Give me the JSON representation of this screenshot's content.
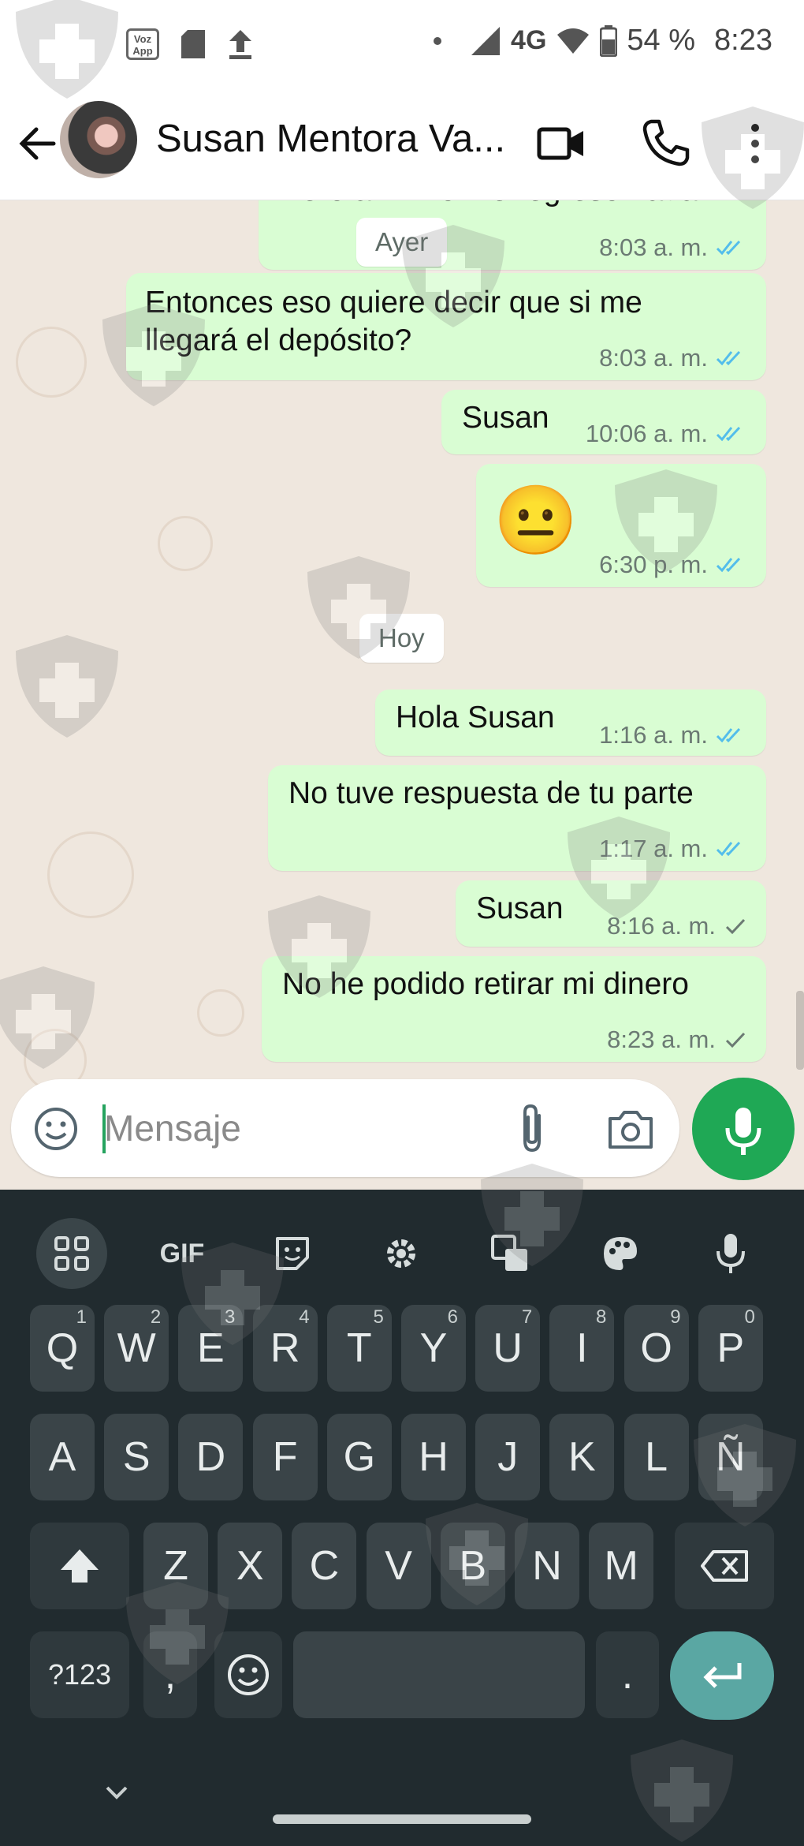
{
  "status_bar": {
    "vozapp_label": "Voz App",
    "network": "4G",
    "battery": "54 %",
    "time": "8:23"
  },
  "header": {
    "contact_name": "Susan Mentora Va..."
  },
  "chat": {
    "partial_message": {
      "text": "Pero a mí no me regresó nada",
      "time": "8:03 a. m."
    },
    "day_labels": {
      "yesterday": "Ayer",
      "today": "Hoy"
    },
    "messages": [
      {
        "text_line1": "Entonces eso quiere decir que si me",
        "text_line2": "llegará el depósito?",
        "time": "8:03 a. m.",
        "status": "read"
      },
      {
        "text": "Susan",
        "time": "10:06 a. m.",
        "status": "read"
      },
      {
        "emoji": "😐",
        "time": "6:30 p. m.",
        "status": "read"
      },
      {
        "text": "Hola Susan",
        "time": "1:16 a. m.",
        "status": "read"
      },
      {
        "text": "No tuve respuesta de tu parte",
        "time": "1:17 a. m.",
        "status": "read"
      },
      {
        "text": "Susan",
        "time": "8:16 a. m.",
        "status": "sent"
      },
      {
        "text": "No he podido retirar mi dinero",
        "time": "8:23 a. m.",
        "status": "sent"
      }
    ]
  },
  "input": {
    "placeholder": "Mensaje"
  },
  "keyboard": {
    "toolbar": [
      "apps-grid",
      "GIF",
      "sticker",
      "settings",
      "translate",
      "theme",
      "voice"
    ],
    "gif_label": "GIF",
    "row1": [
      {
        "k": "Q",
        "n": "1"
      },
      {
        "k": "W",
        "n": "2"
      },
      {
        "k": "E",
        "n": "3"
      },
      {
        "k": "R",
        "n": "4"
      },
      {
        "k": "T",
        "n": "5"
      },
      {
        "k": "Y",
        "n": "6"
      },
      {
        "k": "U",
        "n": "7"
      },
      {
        "k": "I",
        "n": "8"
      },
      {
        "k": "O",
        "n": "9"
      },
      {
        "k": "P",
        "n": "0"
      }
    ],
    "row2": [
      "A",
      "S",
      "D",
      "F",
      "G",
      "H",
      "J",
      "K",
      "L",
      "Ñ"
    ],
    "row3": [
      "Z",
      "X",
      "C",
      "V",
      "B",
      "N",
      "M"
    ],
    "symbols_label": "?123",
    "comma_label": ",",
    "period_label": "."
  },
  "colors": {
    "bubble": "#d9fdd3",
    "accent_green": "#1fa855",
    "read_tick": "#53bdeb",
    "keyboard_bg": "#212b2f"
  }
}
